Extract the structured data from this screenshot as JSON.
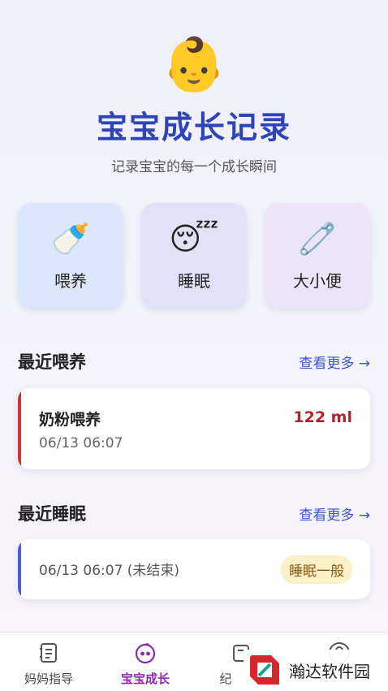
{
  "header": {
    "emoji": "👶",
    "title": "宝宝成长记录",
    "subtitle": "记录宝宝的每一个成长瞬间"
  },
  "categories": [
    {
      "icon": "🍼",
      "label": "喂养",
      "icon_name": "baby-bottle-icon"
    },
    {
      "icon": "😴",
      "label": "睡眠",
      "icon_name": "sleeping-face-icon"
    },
    {
      "icon": "🧷",
      "label": "大小便",
      "icon_name": "safety-pin-icon"
    }
  ],
  "feeding": {
    "section_title": "最近喂养",
    "more_label": "查看更多 →",
    "record": {
      "name": "奶粉喂养",
      "time": "06/13 06:07",
      "amount": "122 ml"
    }
  },
  "sleep": {
    "section_title": "最近睡眠",
    "more_label": "查看更多 →",
    "record": {
      "time": "06/13 06:07 (未结束)",
      "quality": "睡眠一般"
    }
  },
  "tabs": [
    {
      "label": "妈妈指导",
      "active": false
    },
    {
      "label": "宝宝成长",
      "active": true
    },
    {
      "label": "纪",
      "active": false
    },
    {
      "label": "",
      "active": false
    }
  ],
  "watermark": {
    "text": "瀚达软件园"
  },
  "colors": {
    "accent": "#2f44b8",
    "active_tab": "#8c2bb0",
    "feed_bar": "#c9363b",
    "sleep_bar": "#4b5fd0"
  }
}
